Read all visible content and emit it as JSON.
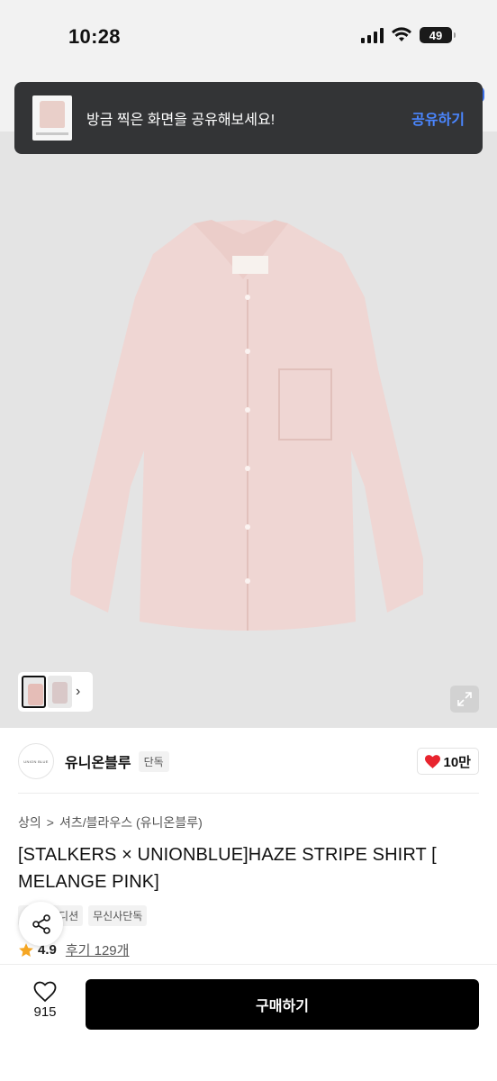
{
  "status_bar": {
    "time": "10:28",
    "battery": "49"
  },
  "toast": {
    "message": "방금 찍은 화면을 공유해보세요!",
    "action_label": "공유하기"
  },
  "brand": {
    "logo_text": "UNION BLUE",
    "name": "유니온블루",
    "badge": "단독",
    "likes": "10만"
  },
  "breadcrumb": {
    "level1": "상의",
    "separator": ">",
    "level2": "셔츠/블라우스 (유니온블루)"
  },
  "product": {
    "title": "[STALKERS × UNIONBLUE]HAZE STRIPE SHIRT [ MELANGE PINK]",
    "tags": [
      "에디션",
      "무신사단독"
    ],
    "rating": "4.9",
    "review_label": "후기 129개"
  },
  "bottom_bar": {
    "wish_count": "915",
    "buy_label": "구매하기"
  },
  "colors": {
    "accent_blue": "#4a86ff",
    "star": "#f5a623",
    "heart": "#e8242e",
    "shirt": "#efd6d3"
  }
}
